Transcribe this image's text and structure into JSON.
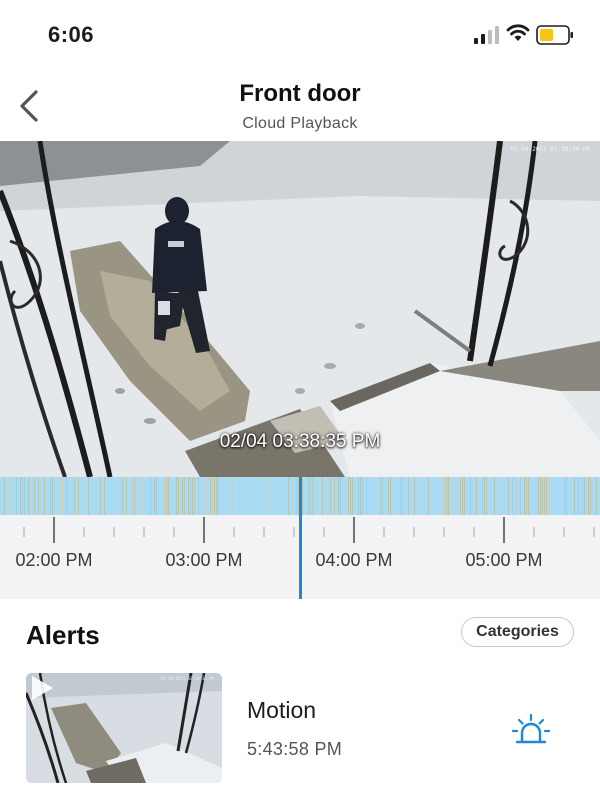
{
  "status_bar": {
    "time": "6:06",
    "icons": [
      "cellular-signal-icon",
      "wifi-icon",
      "battery-icon"
    ],
    "battery_color": "#f5c518"
  },
  "header": {
    "back_icon": "chevron-left-icon",
    "title": "Front door",
    "subtitle": "Cloud Playback"
  },
  "video": {
    "camera_stamp": "02-04-2021 03:38:34 PM",
    "overlay_time": "02/04 03:38:35 PM"
  },
  "timeline": {
    "labels": [
      "02:00 PM",
      "03:00 PM",
      "04:00 PM",
      "05:00 PM"
    ],
    "accent_color": "#1e88d6",
    "strip_color": "#a9dcf3"
  },
  "alerts": {
    "title": "Alerts",
    "categories_label": "Categories",
    "items": [
      {
        "type": "Motion",
        "time": "5:43:58 PM",
        "icon": "motion-alarm-icon",
        "icon_color": "#1e88d6"
      }
    ]
  }
}
